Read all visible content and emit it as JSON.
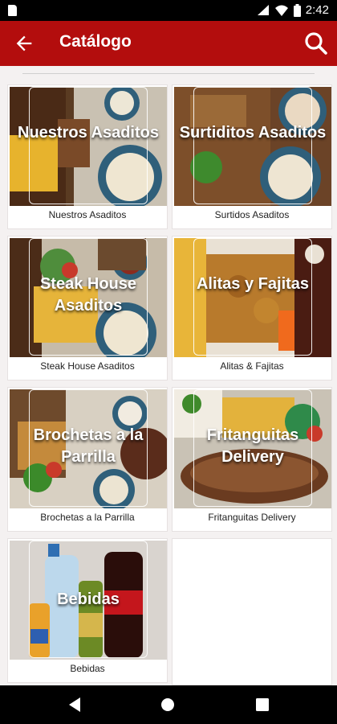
{
  "status_bar": {
    "time": "2:42"
  },
  "app_bar": {
    "title": "Catálogo"
  },
  "catalog": {
    "items": [
      {
        "title_overlay": "Nuestros Asaditos",
        "label": "Nuestros Asaditos"
      },
      {
        "title_overlay": "Surtiditos Asaditos",
        "label": "Surtidos Asaditos"
      },
      {
        "title_overlay": "Steak House Asaditos",
        "label": "Steak House Asaditos"
      },
      {
        "title_overlay": "Alitas y Fajitas",
        "label": "Alitas & Fajitas"
      },
      {
        "title_overlay": "Brochetas a la Parrilla",
        "label": "Brochetas a la Parrilla"
      },
      {
        "title_overlay": "Fritanguitas Delivery",
        "label": "Fritanguitas Delivery"
      },
      {
        "title_overlay": "Bebidas",
        "label": "Bebidas"
      }
    ]
  },
  "colors": {
    "accent": "#b30d0d",
    "status_bar": "#000000",
    "nav_bar": "#000000"
  },
  "icons": {
    "back": "arrow-left-icon",
    "search": "search-icon",
    "nav_back": "triangle-back-icon",
    "nav_home": "circle-home-icon",
    "nav_recents": "square-recents-icon"
  }
}
